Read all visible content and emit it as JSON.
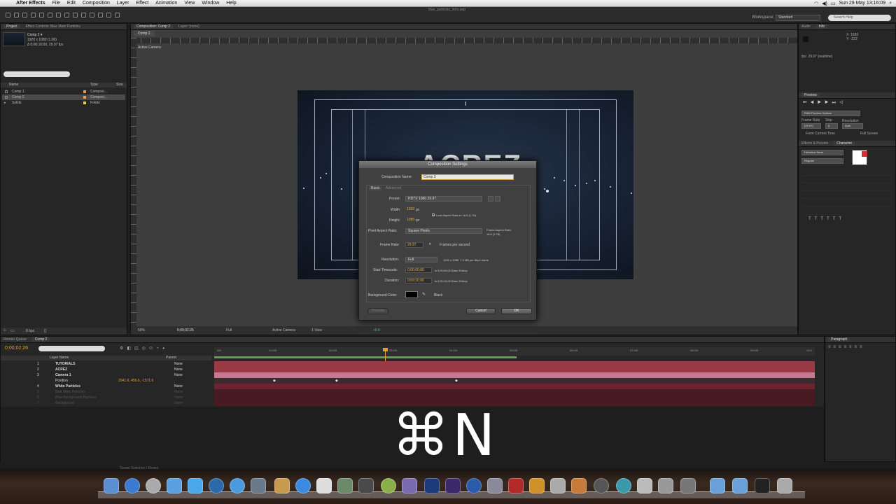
{
  "menubar": {
    "items": [
      "After Effects",
      "File",
      "Edit",
      "Composition",
      "Layer",
      "Effect",
      "Animation",
      "View",
      "Window",
      "Help"
    ],
    "center_title": "blue_particles_intro.aep",
    "clock": "Sun 29 May  13:16:09"
  },
  "toolbar": {
    "workspace_label": "Workspace:",
    "workspace_value": "Standard",
    "search_placeholder": "Search Help"
  },
  "project": {
    "tabs": [
      "Project",
      "Effect Controls: Blue Main Particles"
    ],
    "selected_name": "Comp 2 ▾",
    "selected_info1": "1920 x 1080 (1.00)",
    "selected_info2": "Δ 0;00;10;00, 29.97 fps",
    "col_name": "Name",
    "col_type": "Type",
    "col_size": "Size",
    "items": [
      {
        "name": "Comp 1",
        "type": "Composi...",
        "color": "#e0a050"
      },
      {
        "name": "Comp 2",
        "type": "Composi...",
        "color": "#e0a050"
      },
      {
        "name": "Solids",
        "type": "Folder",
        "color": "#e8d040"
      }
    ],
    "bpc": "8 bpc"
  },
  "viewer": {
    "tabs": [
      "Composition: Comp 2",
      "Layer: (none)"
    ],
    "subtab": "Comp 2",
    "camera_label": "Active Camera",
    "bottom_zoom": "50%",
    "bottom_time": "0;00;02;26",
    "bottom_res": "Full",
    "bottom_view": "Active Camera",
    "bottom_views": "1 View",
    "bottom_offset": "+0.0",
    "canvas_text": "ACREZ"
  },
  "dialog": {
    "title": "Composition Settings",
    "name_label": "Composition Name:",
    "name_value": "Comp 3",
    "tab_basic": "Basic",
    "tab_advanced": "Advanced",
    "preset_label": "Preset:",
    "preset_value": "HDTV 1080 29.97",
    "width_label": "Width:",
    "width_value": "1920",
    "height_label": "Height:",
    "height_value": "1080",
    "px": "px",
    "lock_label": "Lock Aspect Ratio to 16:9 (1.78)",
    "par_label": "Pixel Aspect Ratio:",
    "par_value": "Square Pixels",
    "far_label": "Frame Aspect Ratio:",
    "far_value": "16:9 (1.78)",
    "fps_label": "Frame Rate:",
    "fps_value": "29.97",
    "fps_unit": "Frames per second",
    "res_label": "Resolution:",
    "res_value": "Full",
    "res_info": "1920 x 1080, 7.9 MB per 8bpc frame",
    "start_label": "Start Timecode:",
    "start_value": "0;00;00;00",
    "start_info": "is 0;00;00;00  Base 30drop",
    "dur_label": "Duration:",
    "dur_value": "0;00;10;00",
    "dur_info": "is 0;00;10;00  Base 30drop",
    "bg_label": "Background Color:",
    "bg_name": "Black",
    "preview_btn": "Preview",
    "cancel_btn": "Cancel",
    "ok_btn": "OK"
  },
  "rightpanel": {
    "info_tabs": [
      "Audio",
      "Info"
    ],
    "info_x": "X: 1680",
    "info_y": "Y: -222",
    "info_fps": "fps: 29.97 (realtime)",
    "preview_tab": "Preview",
    "ram_opts": "RAM Preview Options",
    "frame_rate": "Frame Rate",
    "skip": "Skip",
    "resolution": "Resolution",
    "fr_val": "(29.97)",
    "skip_val": "0",
    "res_val": "Auto",
    "from_current": "From Current Time",
    "full_screen": "Full Screen",
    "char_tabs": [
      "Effects & Presets",
      "Character"
    ],
    "font_name": "Helvetica Neue",
    "font_style": "Regular"
  },
  "timeline": {
    "tabs": [
      "Render Queue",
      "Comp 2"
    ],
    "time": "0;00;02;26",
    "col_layer": "Layer Name",
    "col_parent": "Parent",
    "layers": [
      {
        "num": "1",
        "name": "TUTORIALS",
        "parent": "None"
      },
      {
        "num": "2",
        "name": "ACREZ",
        "parent": "None"
      },
      {
        "num": "3",
        "name": "Camera 1",
        "parent": "None"
      },
      {
        "num": "",
        "name": "Position",
        "parent": "2041.6, 456.6, -1571.6"
      },
      {
        "num": "4",
        "name": "White Particles",
        "parent": "None"
      },
      {
        "num": "5",
        "name": "Blue Main Particles",
        "parent": "None"
      },
      {
        "num": "6",
        "name": "Blue Background Particles",
        "parent": "None"
      },
      {
        "num": "7",
        "name": "Background",
        "parent": "None"
      }
    ],
    "ruler_marks": [
      "00f",
      "01:00f",
      "02:00f",
      "03:00f",
      "04:00f",
      "05:00f",
      "06:00f",
      "07:00f",
      "08:00f",
      "09:00f",
      "10:0"
    ],
    "footer": "Toggle Switches / Modes"
  },
  "overlay": {
    "shortcut": "⌘N"
  }
}
